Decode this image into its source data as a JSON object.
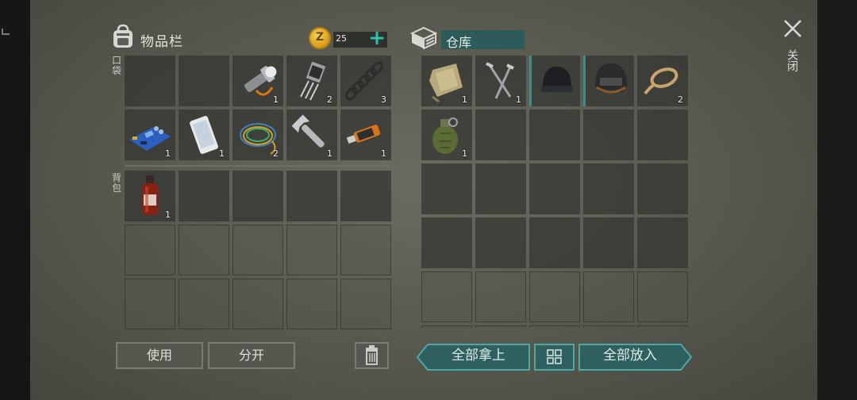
{
  "inventory": {
    "title": "物品栏",
    "coins": "25",
    "pocket_label": "口袋",
    "backpack_label": "背包",
    "pocket_items": [
      {
        "icon": "empty",
        "count": ""
      },
      {
        "icon": "empty",
        "count": ""
      },
      {
        "icon": "flashlight-icon",
        "count": "1"
      },
      {
        "icon": "transistor-icon",
        "count": "2"
      },
      {
        "icon": "spring-icon",
        "count": "3"
      },
      {
        "icon": "circuit-board-icon",
        "count": "1"
      },
      {
        "icon": "smartphone-icon",
        "count": "1"
      },
      {
        "icon": "wire-coil-icon",
        "count": "2"
      },
      {
        "icon": "wrench-icon",
        "count": "1"
      },
      {
        "icon": "usb-drive-icon",
        "count": "1"
      }
    ],
    "backpack_items": [
      {
        "icon": "bottle-icon",
        "count": "1"
      }
    ]
  },
  "warehouse": {
    "title": "仓库",
    "items": [
      {
        "icon": "cloth-icon",
        "count": "1"
      },
      {
        "icon": "nails-icon",
        "count": "1"
      },
      {
        "icon": "beanie-icon",
        "count": ""
      },
      {
        "icon": "helmet-icon",
        "count": ""
      },
      {
        "icon": "rope-icon",
        "count": "2"
      },
      {
        "icon": "grenade-icon",
        "count": "1"
      }
    ]
  },
  "buttons": {
    "use": "使用",
    "split": "分开",
    "take_all": "全部拿上",
    "put_all": "全部放入"
  },
  "close": {
    "label": "关闭"
  },
  "colors": {
    "accent": "#2ec4a8",
    "teal_button": "#2f5f5e",
    "gold": "#e0a91f"
  }
}
